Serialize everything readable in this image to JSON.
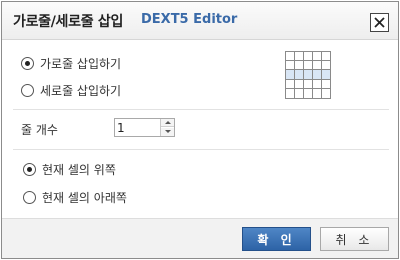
{
  "dialog": {
    "title": "가로줄/세로줄 삽입",
    "brand": "DEXT5 Editor",
    "close_label": "X"
  },
  "direction": {
    "options": [
      {
        "label": "가로줄 삽입하기",
        "checked": true
      },
      {
        "label": "세로줄 삽입하기",
        "checked": false
      }
    ],
    "preview_icon": "table-row-insert-preview-icon"
  },
  "count": {
    "label": "줄 개수",
    "value": "1"
  },
  "position": {
    "options": [
      {
        "label": "현재 셀의 위쪽",
        "checked": true
      },
      {
        "label": "현재 셀의 아래쪽",
        "checked": false
      }
    ]
  },
  "buttons": {
    "ok": "확 인",
    "cancel": "취 소"
  },
  "colors": {
    "accent": "#2d63a6",
    "brand_text": "#3a6aa8",
    "preview_highlight": "#d9e6f5"
  }
}
